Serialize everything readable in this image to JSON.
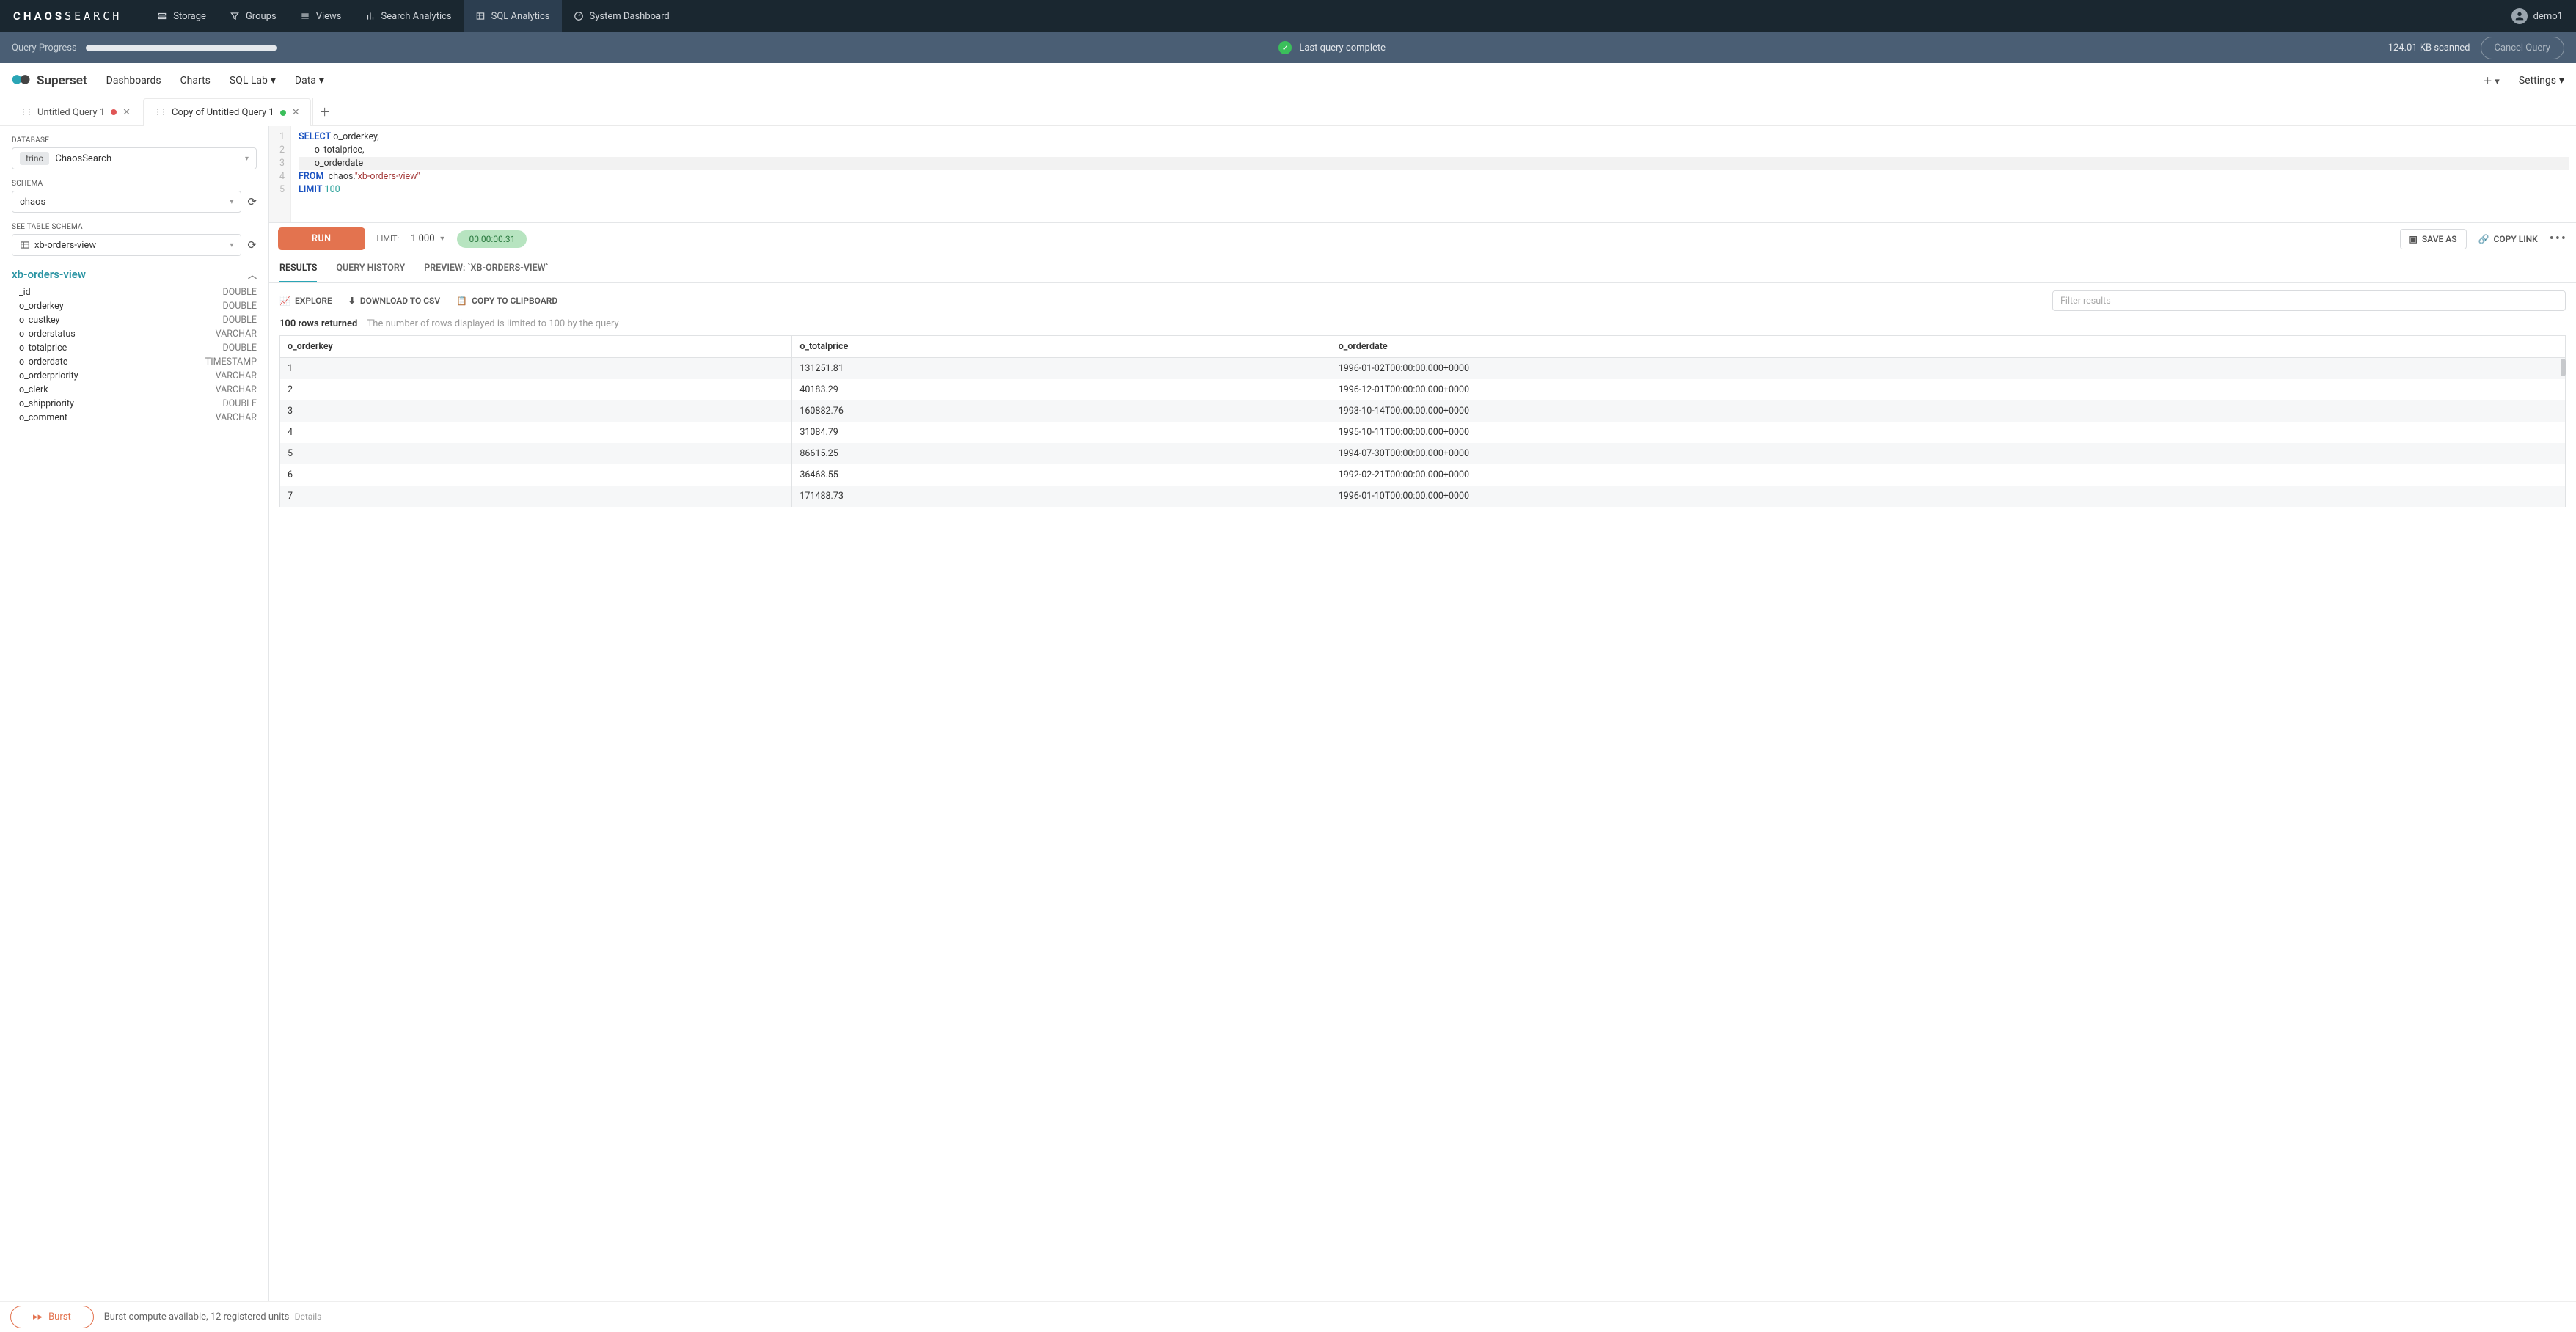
{
  "cs_nav": {
    "items": [
      {
        "label": "Storage"
      },
      {
        "label": "Groups"
      },
      {
        "label": "Views"
      },
      {
        "label": "Search Analytics"
      },
      {
        "label": "SQL Analytics"
      },
      {
        "label": "System Dashboard"
      }
    ],
    "user": "demo1"
  },
  "qp": {
    "label": "Query Progress",
    "status": "Last query complete",
    "scanned": "124.01 KB scanned",
    "cancel": "Cancel Query"
  },
  "ss": {
    "brand": "Superset",
    "nav": {
      "dashboards": "Dashboards",
      "charts": "Charts",
      "sql_lab": "SQL Lab",
      "data": "Data"
    },
    "settings": "Settings"
  },
  "tabs": [
    {
      "label": "Untitled Query 1"
    },
    {
      "label": "Copy of Untitled Query 1"
    }
  ],
  "left": {
    "database_label": "DATABASE",
    "database_pill": "trino",
    "database_value": "ChaosSearch",
    "schema_label": "SCHEMA",
    "schema_value": "chaos",
    "see_table_label": "SEE TABLE SCHEMA",
    "table_value": "xb-orders-view",
    "tree_title": "xb-orders-view",
    "columns": [
      {
        "name": "_id",
        "type": "DOUBLE"
      },
      {
        "name": "o_orderkey",
        "type": "DOUBLE"
      },
      {
        "name": "o_custkey",
        "type": "DOUBLE"
      },
      {
        "name": "o_orderstatus",
        "type": "VARCHAR"
      },
      {
        "name": "o_totalprice",
        "type": "DOUBLE"
      },
      {
        "name": "o_orderdate",
        "type": "TIMESTAMP"
      },
      {
        "name": "o_orderpriority",
        "type": "VARCHAR"
      },
      {
        "name": "o_clerk",
        "type": "VARCHAR"
      },
      {
        "name": "o_shippriority",
        "type": "DOUBLE"
      },
      {
        "name": "o_comment",
        "type": "VARCHAR"
      }
    ]
  },
  "editor": {
    "l1a": "SELECT",
    "l1b": " o_orderkey,",
    "l2": "       o_totalprice,",
    "l3": "       o_orderdate",
    "l4a": "FROM",
    "l4b": "  chaos.",
    "l4c": "\"xb-orders-view\"",
    "l5a": "LIMIT",
    "l5b": " ",
    "l5c": "100"
  },
  "run": {
    "run": "RUN",
    "limit_label": "LIMIT:",
    "limit_value": "1 000",
    "time": "00:00:00.31",
    "save_as": "SAVE AS",
    "copy_link": "COPY LINK"
  },
  "result_tabs": {
    "results": "RESULTS",
    "history": "QUERY HISTORY",
    "preview": "PREVIEW: `XB-ORDERS-VIEW`"
  },
  "res_toolbar": {
    "explore": "EXPLORE",
    "download": "DOWNLOAD TO CSV",
    "copy": "COPY TO CLIPBOARD",
    "filter_placeholder": "Filter results"
  },
  "res_meta": {
    "returned": "100 rows returned",
    "note": "The number of rows displayed is limited to 100 by the query"
  },
  "table": {
    "headers": [
      "o_orderkey",
      "o_totalprice",
      "o_orderdate"
    ],
    "rows": [
      [
        "1",
        "131251.81",
        "1996-01-02T00:00:00.000+0000"
      ],
      [
        "2",
        "40183.29",
        "1996-12-01T00:00:00.000+0000"
      ],
      [
        "3",
        "160882.76",
        "1993-10-14T00:00:00.000+0000"
      ],
      [
        "4",
        "31084.79",
        "1995-10-11T00:00:00.000+0000"
      ],
      [
        "5",
        "86615.25",
        "1994-07-30T00:00:00.000+0000"
      ],
      [
        "6",
        "36468.55",
        "1992-02-21T00:00:00.000+0000"
      ],
      [
        "7",
        "171488.73",
        "1996-01-10T00:00:00.000+0000"
      ]
    ]
  },
  "burst": {
    "btn": "Burst",
    "text": "Burst compute available, 12 registered units",
    "details": "Details"
  }
}
